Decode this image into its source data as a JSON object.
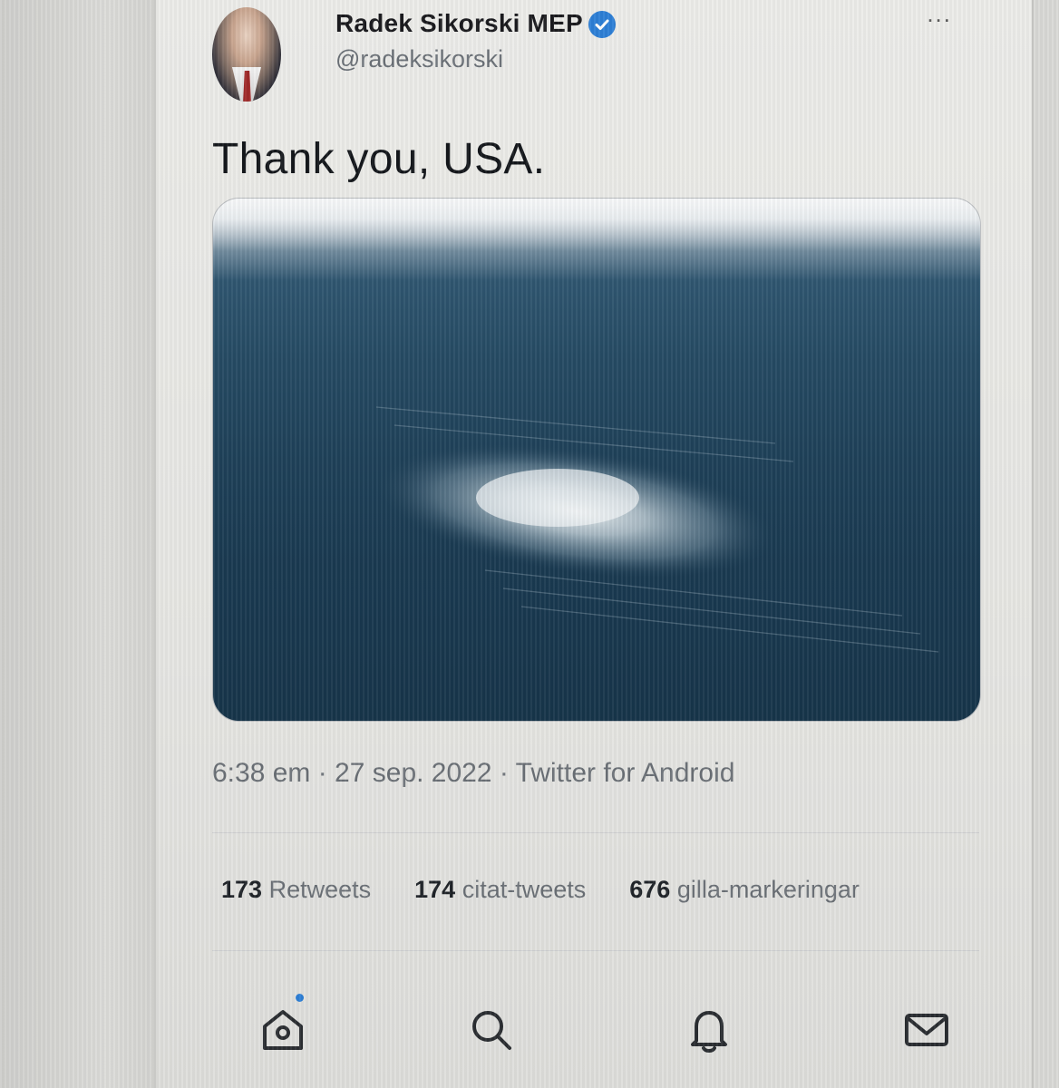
{
  "profile": {
    "name": "Radek Sikorski MEP",
    "handle": "@radeksikorski",
    "verified": true,
    "verified_color": "#2d7fd6"
  },
  "menu": {
    "more_label": "..."
  },
  "tweet": {
    "text": "Thank you, USA.",
    "image_alt_icon": "aerial-sea-photo",
    "meta": "6:38 em · 27 sep. 2022 · Twitter for Android"
  },
  "stats": [
    {
      "count": "173",
      "label": "Retweets"
    },
    {
      "count": "174",
      "label": "citat-tweets"
    },
    {
      "count": "676",
      "label": "gilla-markeringar"
    }
  ],
  "nav": {
    "items": [
      {
        "icon": "home-icon",
        "has_notification_dot": true
      },
      {
        "icon": "search-icon"
      },
      {
        "icon": "bell-icon"
      },
      {
        "icon": "mail-icon"
      }
    ],
    "accent": "#2d7fd6"
  }
}
